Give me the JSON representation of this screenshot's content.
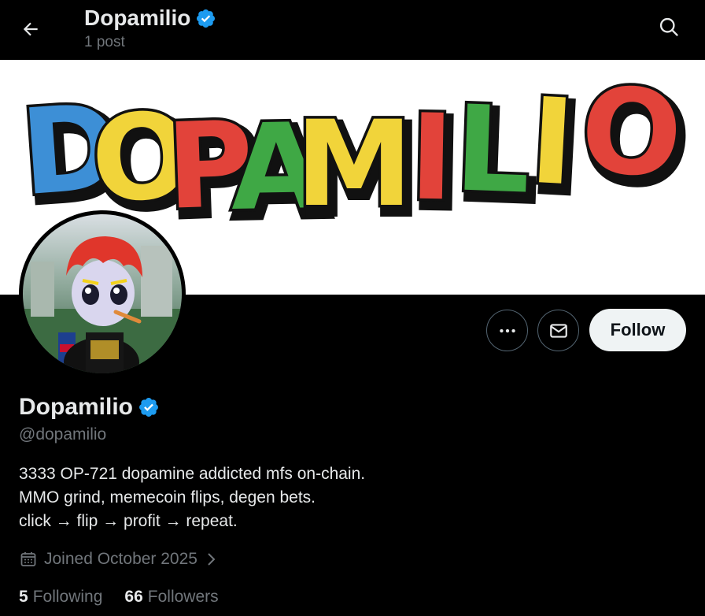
{
  "header": {
    "title": "Dopamilio",
    "subtitle": "1 post",
    "back_icon": "arrow-left-icon",
    "search_icon": "search-icon"
  },
  "banner": {
    "text": "DOPAMILIO",
    "letter_colors": [
      "#3d8fd6",
      "#f1d43a",
      "#e2433a",
      "#3fa845",
      "#f1d43a",
      "#e2433a",
      "#3fa845",
      "#f1d43a",
      "#e2433a"
    ]
  },
  "profile": {
    "name": "Dopamilio",
    "handle": "@dopamilio",
    "verified": true,
    "bio": [
      "3333 OP-721 dopamine addicted mfs on-chain.",
      "MMO grind, memecoin flips, degen bets.",
      "click → flip → profit → repeat."
    ],
    "joined": "Joined October 2025",
    "following_count": "5",
    "following_label": "Following",
    "followers_count": "66",
    "followers_label": "Followers"
  },
  "actions": {
    "more_icon": "more-horizontal-icon",
    "message_icon": "envelope-icon",
    "follow_label": "Follow"
  },
  "colors": {
    "verified": "#1d9bf0",
    "follow_bg": "#eff3f4",
    "muted": "#71767b"
  }
}
